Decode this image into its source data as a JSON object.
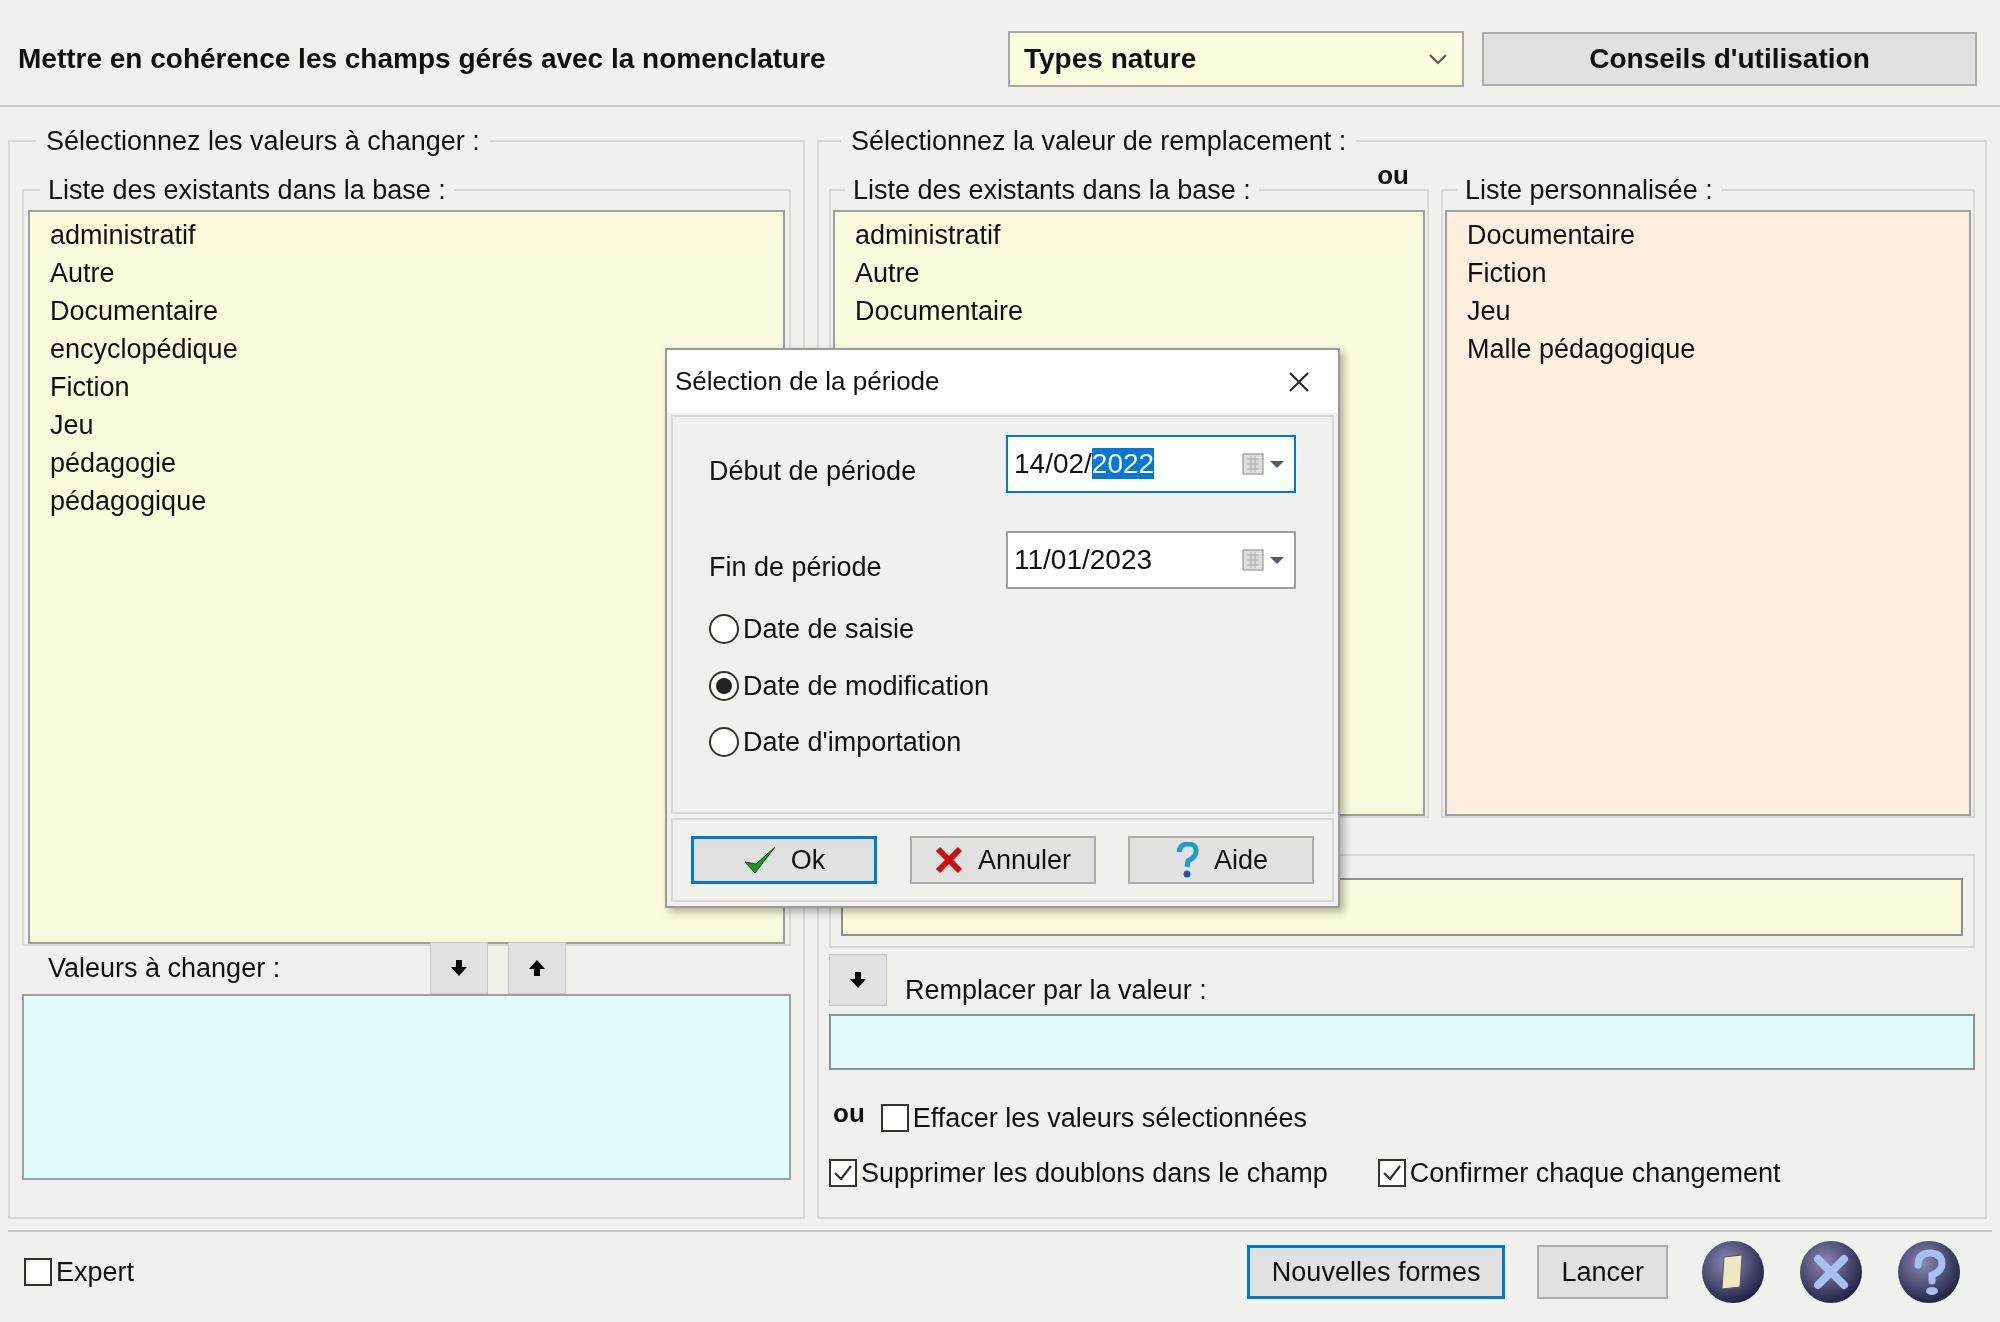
{
  "header": {
    "title": "Mettre en cohérence les champs gérés avec la nomenclature",
    "field_select": {
      "value": "Types nature"
    },
    "advice_button": "Conseils d'utilisation"
  },
  "left": {
    "title": "Sélectionnez les valeurs à changer :",
    "existing": {
      "title": "Liste des existants dans la base :",
      "items": [
        "administratif",
        "Autre",
        "Documentaire",
        "encyclopédique",
        "Fiction",
        "Jeu",
        "pédagogie",
        "pédagogique"
      ]
    },
    "to_change": {
      "title": "Valeurs à changer :"
    }
  },
  "right": {
    "title": "Sélectionnez la valeur de remplacement :",
    "or_label": "ou",
    "existing": {
      "title": "Liste des existants dans la base :",
      "items": [
        "administratif",
        "Autre",
        "Documentaire"
      ]
    },
    "custom": {
      "title": "Liste personnalisée :",
      "items": [
        "Documentaire",
        "Fiction",
        "Jeu",
        "Malle pédagogique"
      ]
    },
    "replace_label": "Remplacer par la valeur :",
    "or_label_2": "ou",
    "options": [
      {
        "label": "Effacer les valeurs sélectionnées",
        "checked": false
      },
      {
        "label": "Supprimer les doublons dans le champ",
        "checked": true
      },
      {
        "label": "Confirmer chaque changement",
        "checked": true
      }
    ]
  },
  "footer": {
    "expert": {
      "label": "Expert",
      "checked": false
    },
    "buttons": [
      {
        "label": "Nouvelles formes",
        "focused": true
      },
      {
        "label": "Lancer",
        "focused": false
      }
    ]
  },
  "dialog": {
    "title": "Sélection de la période",
    "fields": [
      {
        "label": "Début de période",
        "value": "14/02/",
        "highlighted": "2022",
        "focused": true
      },
      {
        "label": "Fin de période",
        "value": "11/01/2023",
        "focused": false
      }
    ],
    "radios": [
      {
        "label": "Date de saisie",
        "selected": false
      },
      {
        "label": "Date de modification",
        "selected": true
      },
      {
        "label": "Date d'importation",
        "selected": false
      }
    ],
    "buttons": [
      {
        "kind": "ok",
        "label": "Ok",
        "focused": true
      },
      {
        "kind": "cancel",
        "label": "Annuler",
        "focused": false
      },
      {
        "kind": "help",
        "label": "Aide",
        "focused": false
      }
    ]
  }
}
